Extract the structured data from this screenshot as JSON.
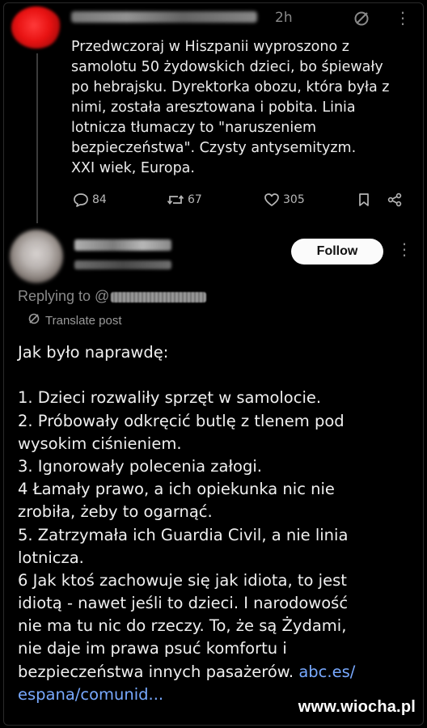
{
  "post1": {
    "time": "2h",
    "text_lines": [
      "Przedwczoraj w Hiszpanii wyproszono z",
      "samolotu 50 żydowskich dzieci, bo śpiewały",
      "po hebrajsku. Dyrektorka obozu, która była z",
      "nimi, została aresztowana i pobita. Linia",
      "lotnicza tłumaczy to \"naruszeniem",
      "bezpieczeństwa\". Czysty antysemityzm.",
      "XXI wiek, Europa."
    ],
    "stats": {
      "comments": "84",
      "reposts": "67",
      "likes": "305"
    }
  },
  "post2": {
    "follow_label": "Follow",
    "replying_to_label": "Replying to @",
    "translate_label": "Translate post",
    "heading": "Jak było naprawdę:",
    "lines": [
      "1. Dzieci rozwaliły sprzęt w samolocie.",
      "2. Próbowały odkręcić butlę z tlenem pod",
      "wysokim ciśnieniem.",
      "3. Ignorowały polecenia załogi.",
      "4 Łamały prawo, a ich opiekunka nic nie",
      "zrobiła, żeby to ogarnąć.",
      "5. Zatrzymała ich Guardia Civil, a nie linia",
      "lotnicza.",
      "6 Jak ktoś zachowuje się jak idiota, to jest",
      "idiotą - nawet jeśli to dzieci. I narodowość",
      "nie ma tu nic do rzeczy. To, że są Żydami,",
      "nie daje im prawa psuć komfortu i"
    ],
    "last_line_text": "bezpieczeństwa innych pasażerów. ",
    "link_part1": "abc.es/",
    "link_part2": "espana/comunid..."
  },
  "watermark": "www.wiocha.pl",
  "colors": {
    "background": "#000000",
    "link": "#78a9ff",
    "muted": "#8a8a8a",
    "follow_bg": "#fbfbfb"
  },
  "icons": [
    "mute-icon",
    "more-icon",
    "comment-icon",
    "repost-icon",
    "heart-icon",
    "bookmark-icon",
    "share-icon",
    "translate-icon"
  ]
}
